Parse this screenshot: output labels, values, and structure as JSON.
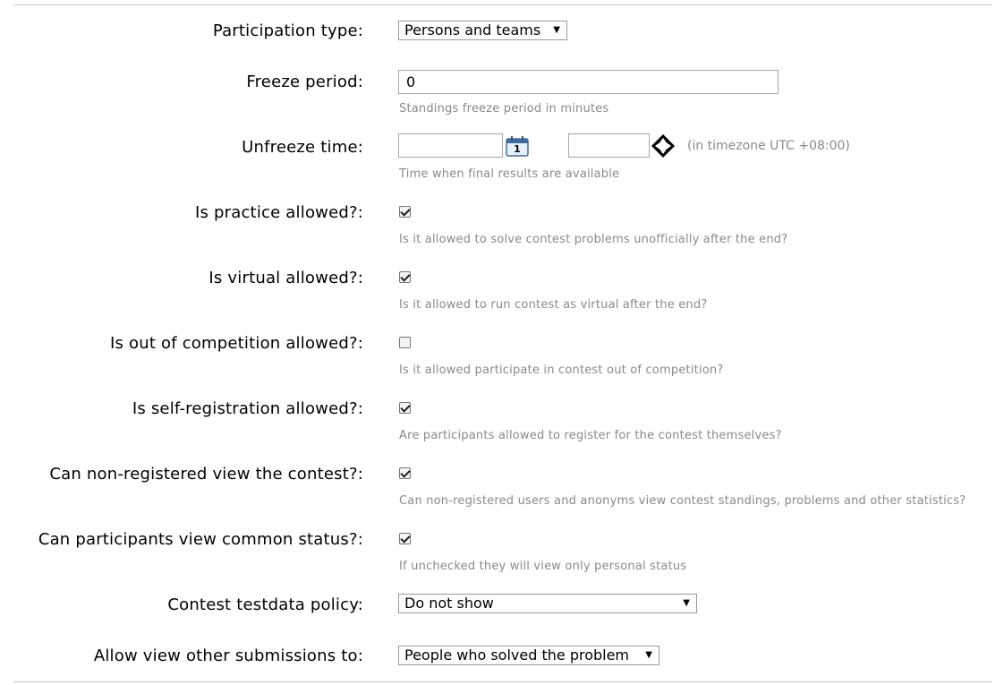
{
  "fields": {
    "participation_type": {
      "label": "Participation type:",
      "value": "Persons and teams"
    },
    "freeze_period": {
      "label": "Freeze period:",
      "value": "0",
      "hint": "Standings freeze period in minutes"
    },
    "unfreeze_time": {
      "label": "Unfreeze time:",
      "date_value": "",
      "time_value": "",
      "timezone_note": "(in timezone UTC +08:00)",
      "hint": "Time when final results are available",
      "calendar_icon_day": "1"
    },
    "practice_allowed": {
      "label": "Is practice allowed?:",
      "checked": true,
      "hint": "Is it allowed to solve contest problems unofficially after the end?"
    },
    "virtual_allowed": {
      "label": "Is virtual allowed?:",
      "checked": true,
      "hint": "Is it allowed to run contest as virtual after the end?"
    },
    "out_of_competition_allowed": {
      "label": "Is out of competition allowed?:",
      "checked": false,
      "hint": "Is it allowed participate in contest out of competition?"
    },
    "self_registration_allowed": {
      "label": "Is self-registration allowed?:",
      "checked": true,
      "hint": "Are participants allowed to register for the contest themselves?"
    },
    "non_registered_view": {
      "label": "Can non-registered view the contest?:",
      "checked": true,
      "hint": "Can non-registered users and anonyms view contest standings, problems and other statistics?"
    },
    "common_status": {
      "label": "Can participants view common status?:",
      "checked": true,
      "hint": "If unchecked they will view only personal status"
    },
    "testdata_policy": {
      "label": "Contest testdata policy:",
      "value": "Do not show"
    },
    "view_other_submissions": {
      "label": "Allow view other submissions to:",
      "value": "People who solved the problem"
    }
  },
  "icons": {
    "dropdown_arrow": "▼",
    "calendar": "calendar-icon",
    "time_picker": "clock-picker-icon"
  }
}
